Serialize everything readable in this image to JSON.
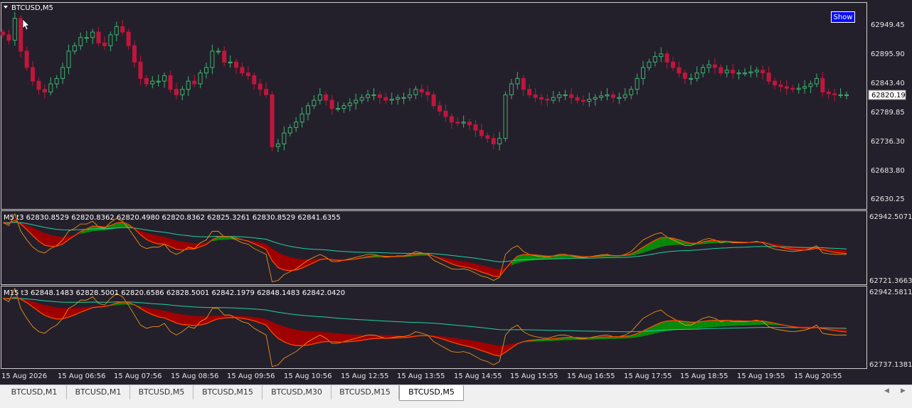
{
  "symbol_title": "BTCUSD,M5",
  "show_button": "Show",
  "current_price": "62820.19",
  "colors": {
    "background": "#24202b",
    "bull_candle": "#3cb371",
    "bear_candle": "#c0163c",
    "ribbon_bull": "#0a8a0a",
    "ribbon_bear": "#a00000",
    "fast_line": "#ff4500",
    "slow_line": "#1ed2a0",
    "price_line": "#ff9f1a",
    "button": "#0a0aff"
  },
  "main_pane": {
    "price_labels": [
      "62949.45",
      "62895.90",
      "62843.40",
      "62789.85",
      "62736.30",
      "62683.80",
      "62630.25"
    ]
  },
  "indicator_m5": {
    "legend": "M5 t3  62830.8529 62820.8362 62820.4980 62820.8362 62825.3261 62830.8529 62841.6355",
    "scale_top": "62942.5071",
    "scale_bottom": "62721.3663"
  },
  "indicator_m15": {
    "legend": "M15 t3  62848.1483 62828.5001 62820.6586 62828.5001 62842.1979 62848.1483 62842.0420",
    "scale_top": "62942.5811",
    "scale_bottom": "62737.1381"
  },
  "time_labels": [
    "15 Aug 2026",
    "15 Aug 06:56",
    "15 Aug 07:56",
    "15 Aug 08:56",
    "15 Aug 09:56",
    "15 Aug 10:56",
    "15 Aug 12:55",
    "15 Aug 13:55",
    "15 Aug 14:55",
    "15 Aug 15:55",
    "15 Aug 16:55",
    "15 Aug 17:55",
    "15 Aug 18:55",
    "15 Aug 19:55",
    "15 Aug 20:55"
  ],
  "tabs": [
    "BTCUSD,M1",
    "BTCUSD,M1",
    "BTCUSD,M5",
    "BTCUSD,M15",
    "BTCUSD,M30",
    "BTCUSD,M15",
    "BTCUSD,M5"
  ],
  "active_tab_index": 6,
  "price_path": [
    62930,
    62920,
    62960,
    62900,
    62870,
    62845,
    62830,
    62825,
    62840,
    62850,
    62870,
    62900,
    62910,
    62925,
    62925,
    62935,
    62915,
    62910,
    62930,
    62945,
    62935,
    62910,
    62880,
    62850,
    62840,
    62845,
    62845,
    62855,
    62830,
    62820,
    62830,
    62845,
    62840,
    62860,
    62870,
    62900,
    62900,
    62880,
    62880,
    62870,
    62860,
    62855,
    62840,
    62830,
    62820,
    62725,
    62730,
    62750,
    62760,
    62770,
    62785,
    62800,
    62810,
    62820,
    62810,
    62795,
    62795,
    62800,
    62805,
    62810,
    62815,
    62820,
    62820,
    62815,
    62810,
    62812,
    62815,
    62815,
    62820,
    62830,
    62825,
    62820,
    62800,
    62790,
    62780,
    62770,
    62768,
    62770,
    62765,
    62755,
    62745,
    62740,
    62730,
    62740,
    62820,
    62840,
    62850,
    62830,
    62820,
    62815,
    62812,
    62810,
    62815,
    62820,
    62820,
    62815,
    62810,
    62808,
    62812,
    62815,
    62818,
    62820,
    62815,
    62815,
    62820,
    62830,
    62850,
    62870,
    62880,
    62890,
    62895,
    62880,
    62870,
    62860,
    62850,
    62850,
    62860,
    62870,
    62875,
    62870,
    62860,
    62865,
    62860,
    62860,
    62860,
    62862,
    62865,
    62860,
    62845,
    62838,
    62835,
    62832,
    62830,
    62832,
    62835,
    62840,
    62850,
    62825,
    62822,
    62820,
    62820,
    62820
  ]
}
